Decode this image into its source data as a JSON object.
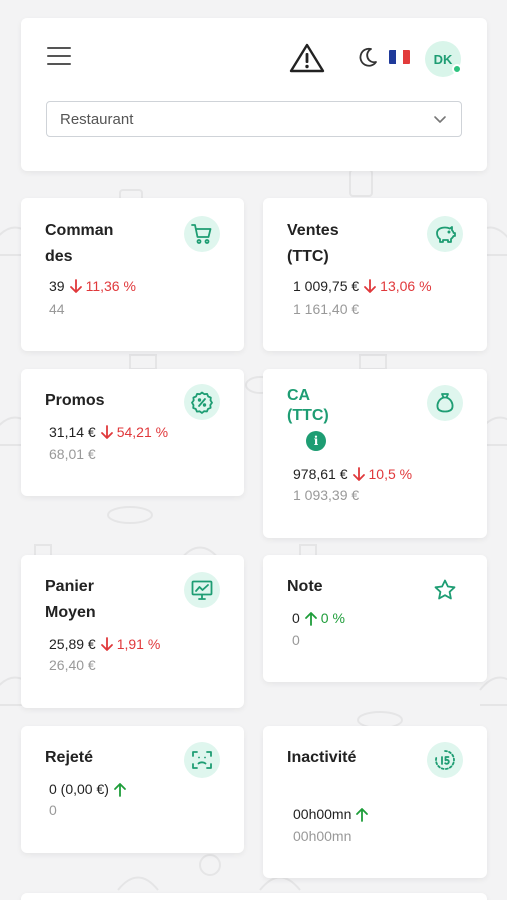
{
  "header": {
    "store_select": "Restaurant"
  },
  "user": {
    "initials": "DK"
  },
  "colors": {
    "accent": "#1e9d73",
    "negative": "#e0383b",
    "positive": "#1e9d3a",
    "icon_bg": "#dff6ee"
  },
  "cards": [
    {
      "title": "Commandes",
      "value": "39",
      "change": "11,36 %",
      "trend": "down",
      "previous": "44",
      "icon": "cart-icon"
    },
    {
      "title": "Ventes (TTC)",
      "value": "1 009,75 €",
      "change": "13,06 %",
      "trend": "down",
      "previous": "1 161,40 €",
      "icon": "piggy-bank-icon"
    },
    {
      "title": "Promos",
      "value": "31,14 €",
      "change": "54,21 %",
      "trend": "down",
      "previous": "68,01 €",
      "icon": "discount-badge-icon"
    },
    {
      "title": "CA (TTC)",
      "value": "978,61 €",
      "change": "10,5 %",
      "trend": "down",
      "previous": "1 093,39 €",
      "icon": "money-bag-icon",
      "info_symbol": "i"
    },
    {
      "title": "Panier Moyen",
      "value": "25,89 €",
      "change": "1,91 %",
      "trend": "down",
      "previous": "26,40 €",
      "icon": "chart-monitor-icon"
    },
    {
      "title": "Note",
      "value": "0",
      "change": "0 %",
      "trend": "up",
      "previous": "0",
      "icon": "star-icon"
    },
    {
      "title": "Rejeté",
      "value": "0 (0,00 €)",
      "change": "",
      "trend": "up",
      "previous": "0",
      "icon": "scan-face-icon"
    },
    {
      "title": "Inactivité",
      "value": "00h00mn",
      "change": "",
      "trend": "up",
      "previous": "00h00mn",
      "icon": "timer-15-icon"
    }
  ]
}
